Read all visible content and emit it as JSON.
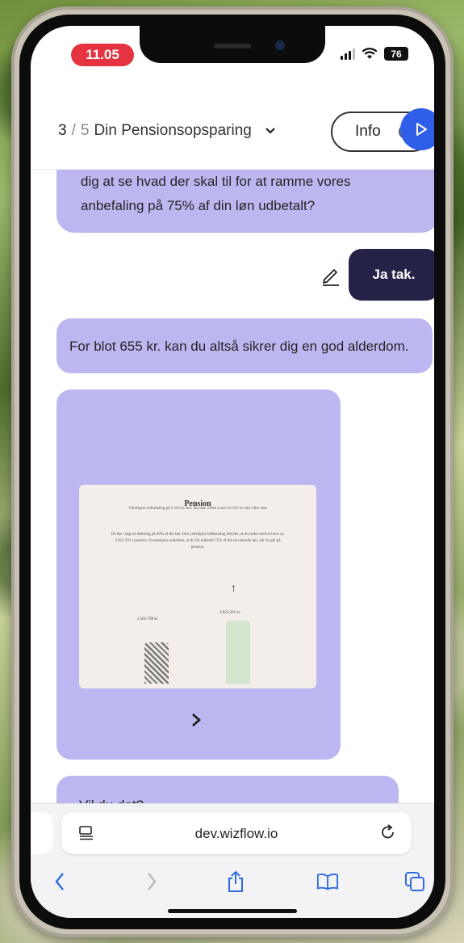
{
  "status_bar": {
    "time": "11.05",
    "battery": "76",
    "icons": [
      "signal-icon",
      "wifi-icon",
      "battery-icon"
    ]
  },
  "header": {
    "step_current": "3",
    "step_separator": "/",
    "step_total": "5",
    "title": "Din Pensionsopsparing",
    "info_label": "Info",
    "colors": {
      "play_button": "#2f5ee8"
    }
  },
  "chat": {
    "colors": {
      "bot_bubble": "#bcb7f0",
      "user_bubble": "#242347"
    },
    "messages": [
      {
        "from": "bot",
        "lines": [
          "dig at se hvad der skal til for at ramme vores",
          "anbefaling på 75% af din løn udbetalt?"
        ]
      },
      {
        "from": "user",
        "text": "Ja tak."
      },
      {
        "from": "bot",
        "text": "For blot 655 kr. kan du altså sikrer dig en god alderdom."
      },
      {
        "from": "bot",
        "card": {
          "title": "Pension",
          "subtitle": "Yderligere indbetaling på 1.545 kr./md. før skat. Dette svarer til 655 kr./md. efter skat",
          "body": "Du har i dag en dækning på 49% af din løn. Den yderligere indbetaling betyder, at du neder med at have ca. 3.922.291 i pension. Svenamplus anbefaler, at du får udbetalt 75% af din nuværende løn, når du går på pension.",
          "bar_labels": [
            "2.563.708 kr.",
            "3.922.291 kr."
          ],
          "bar_values": [
            2563708,
            3922291
          ]
        }
      },
      {
        "from": "bot",
        "text": "Vil du det?"
      }
    ]
  },
  "browser": {
    "url": "dev.wizflow.io",
    "icons": [
      "reader-icon",
      "reload-icon",
      "back-icon",
      "forward-icon",
      "share-icon",
      "bookmarks-icon",
      "tabs-icon"
    ]
  }
}
